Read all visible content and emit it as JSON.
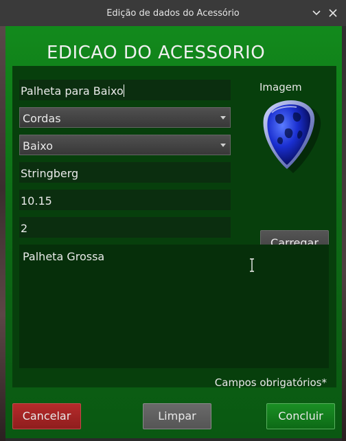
{
  "window": {
    "title": "Edição de dados do Acessório",
    "heading": "EDICAO DO ACESSORIO"
  },
  "form": {
    "name_value": "Palheta para Baixo",
    "category_value": "Cordas",
    "type_value": "Baixo",
    "brand_value": "Stringberg",
    "price_value": "10.15",
    "quantity_value": "2",
    "description_value": "Palheta Grossa"
  },
  "image": {
    "label": "Imagem",
    "upload_label": "Carregar",
    "icon": "guitar-pick-icon"
  },
  "footer": {
    "required_note": "Campos obrigatórios*",
    "cancel_label": "Cancelar",
    "clear_label": "Limpar",
    "finish_label": "Concluir"
  },
  "colors": {
    "background_green": "#128a1c",
    "cancel_red": "#a62424",
    "finish_green": "#13801d"
  }
}
